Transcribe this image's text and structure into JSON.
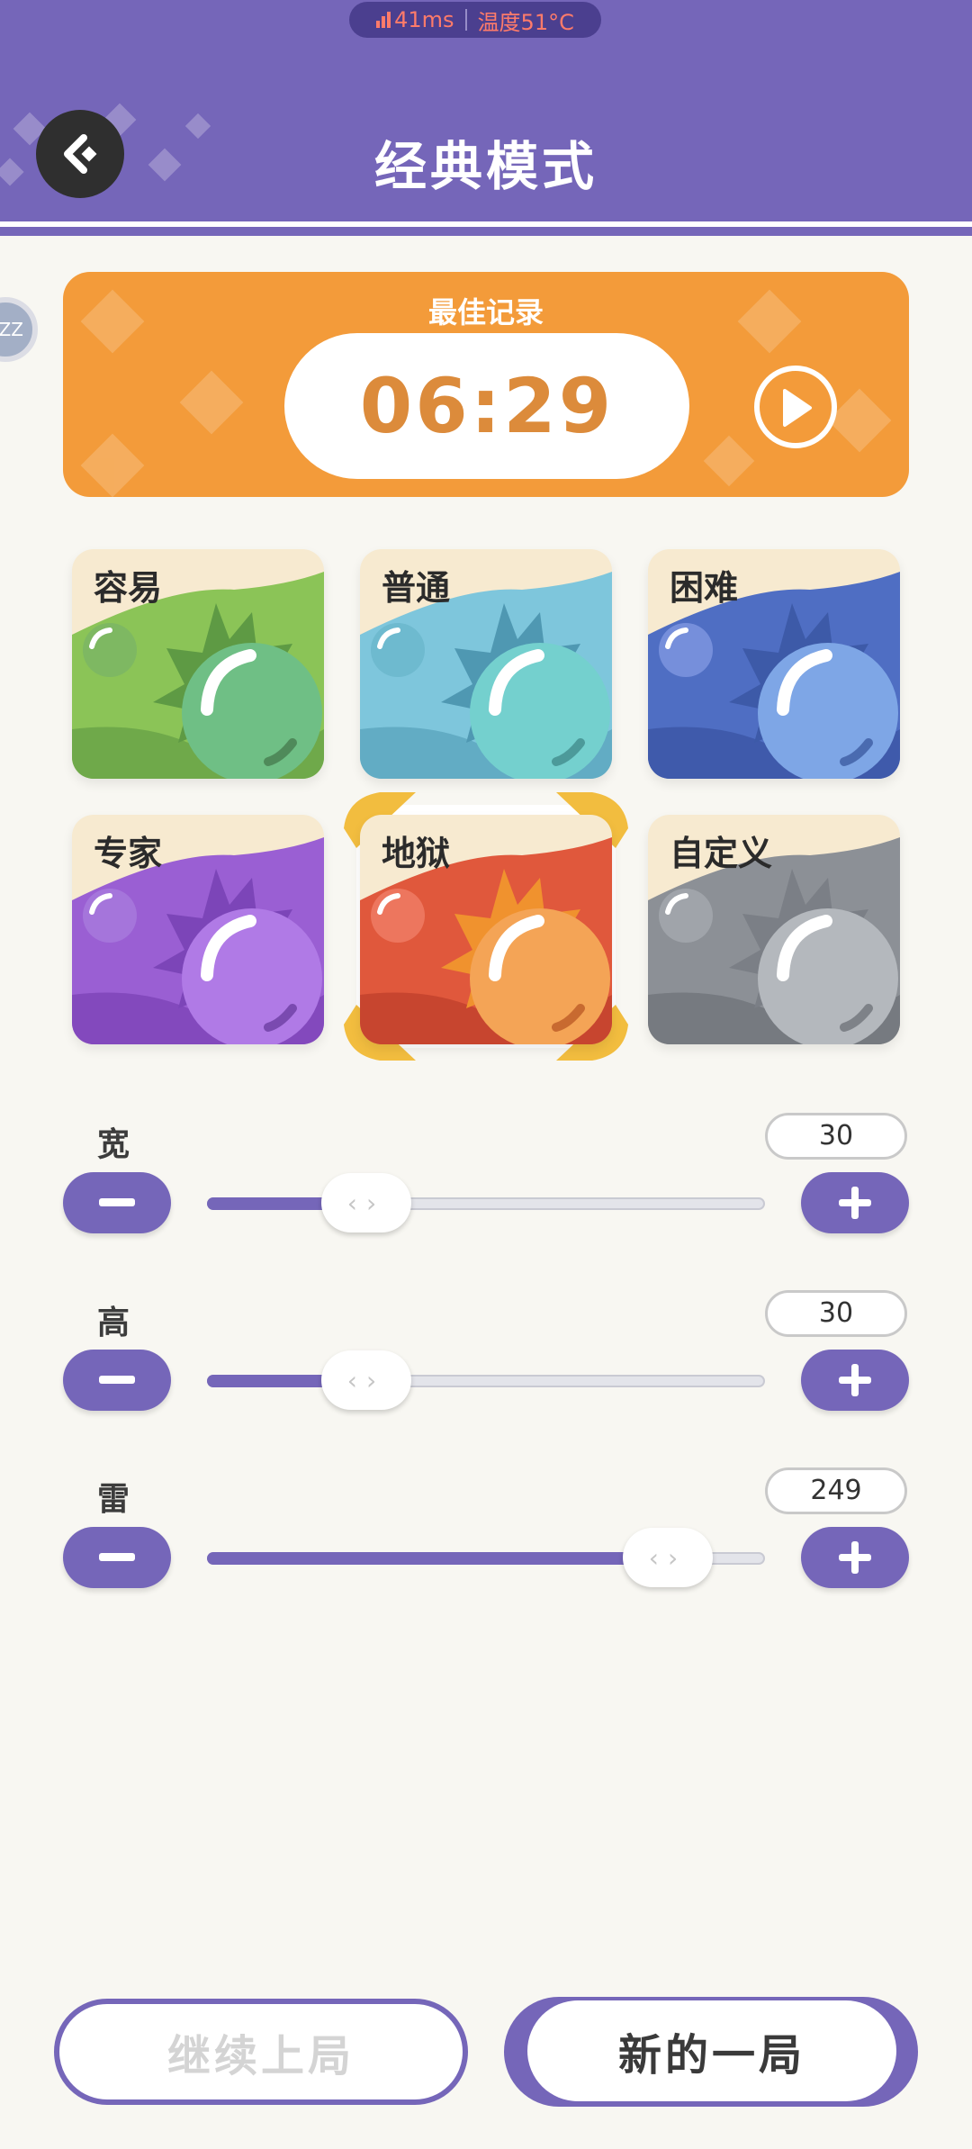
{
  "status_bar": {
    "latency": "41ms",
    "temperature": "温度51°C",
    "accent": "#ff7b6a"
  },
  "header": {
    "title": "经典模式",
    "back_icon": "back-arrow-icon",
    "bg": "#7566b9"
  },
  "side_widget": {
    "text": "ZZ"
  },
  "best_record": {
    "title": "最佳记录",
    "time": "06:29",
    "play_icon": "play-icon"
  },
  "difficulties": [
    {
      "label": "容易",
      "selected": false
    },
    {
      "label": "普通",
      "selected": false
    },
    {
      "label": "困难",
      "selected": false
    },
    {
      "label": "专家",
      "selected": false
    },
    {
      "label": "地狱",
      "selected": true
    },
    {
      "label": "自定义",
      "selected": false
    }
  ],
  "settings": {
    "width": {
      "label": "宽",
      "value": "30",
      "fraction": 0.24
    },
    "height": {
      "label": "高",
      "value": "30",
      "fraction": 0.24
    },
    "mines": {
      "label": "雷",
      "value": "249",
      "fraction": 0.78
    }
  },
  "buttons": {
    "continue": "继续上局",
    "new_game": "新的一局"
  }
}
